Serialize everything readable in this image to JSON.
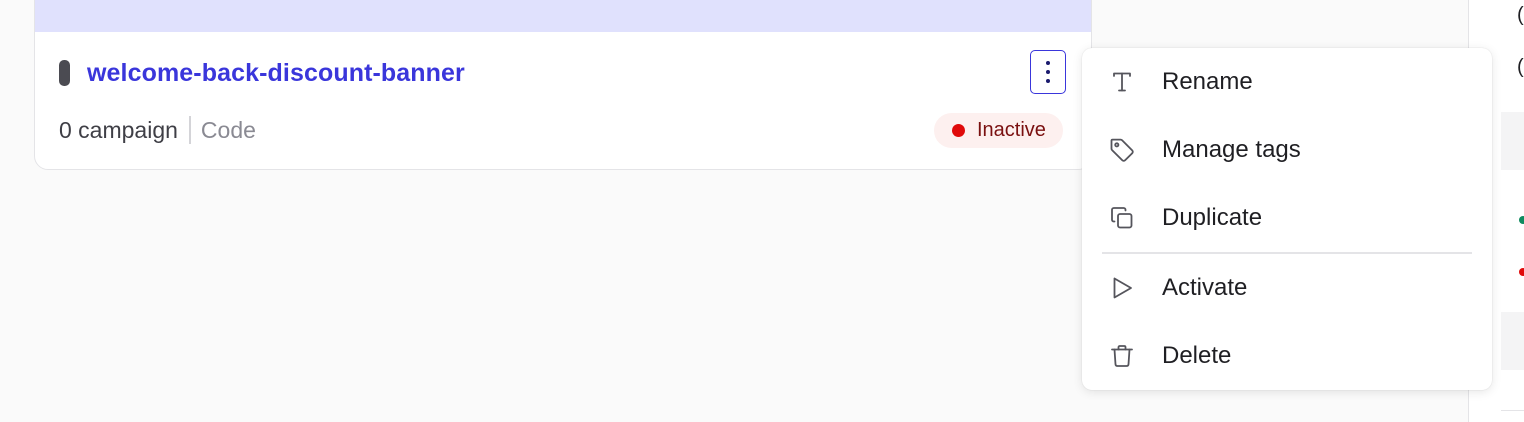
{
  "card": {
    "title": "welcome-back-discount-banner",
    "campaign_count": "0 campaign",
    "type": "Code",
    "status": {
      "label": "Inactive",
      "dot_color": "#e00a0a"
    },
    "preview_color": "#e0e1fd",
    "title_color": "#3a36db",
    "more_icon": "kebab-vertical-icon"
  },
  "menu": {
    "items": [
      {
        "label": "Rename",
        "icon": "text-icon"
      },
      {
        "label": "Manage tags",
        "icon": "tag-icon"
      },
      {
        "label": "Duplicate",
        "icon": "copy-icon"
      },
      {
        "label": "Activate",
        "icon": "play-icon"
      },
      {
        "label": "Delete",
        "icon": "trash-icon"
      }
    ]
  },
  "right_panel": {
    "status_colors": [
      "#0f8a5f",
      "#e00a0a"
    ]
  }
}
